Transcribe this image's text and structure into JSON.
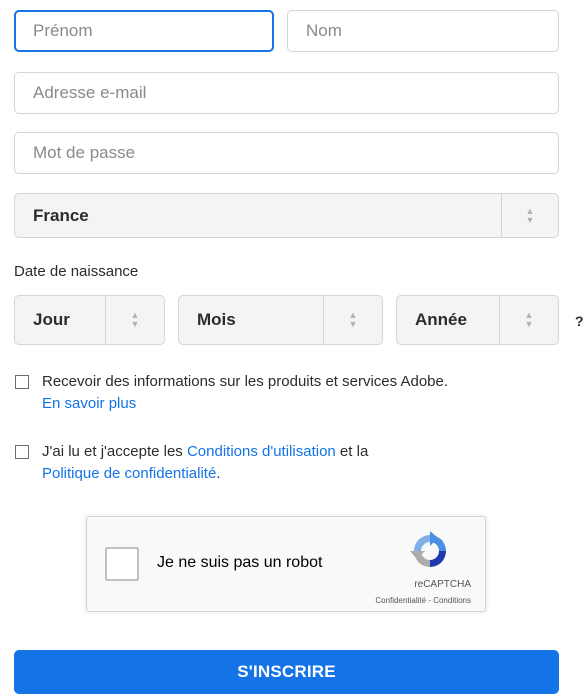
{
  "form": {
    "first_name": {
      "placeholder": "Prénom",
      "value": ""
    },
    "last_name": {
      "placeholder": "Nom",
      "value": ""
    },
    "email": {
      "placeholder": "Adresse e-mail",
      "value": ""
    },
    "password": {
      "placeholder": "Mot de passe",
      "value": ""
    },
    "country": {
      "selected": "France"
    },
    "birthdate": {
      "label": "Date de naissance",
      "day": "Jour",
      "month": "Mois",
      "year": "Année",
      "help": "?"
    },
    "newsletter": {
      "checked": false,
      "text": "Recevoir des informations sur les produits et services Adobe.",
      "link": "En savoir plus"
    },
    "terms": {
      "checked": false,
      "text_before": "J'ai lu et j'accepte les ",
      "link_terms": "Conditions d'utilisation",
      "text_middle": " et la",
      "link_privacy": "Politique de confidentialité",
      "text_after": "."
    },
    "recaptcha": {
      "label": "Je ne suis pas un robot",
      "brand": "reCAPTCHA",
      "privacy": "Confidentialité",
      "separator": " - ",
      "terms": "Conditions"
    },
    "submit_label": "S'INSCRIRE"
  },
  "colors": {
    "accent": "#1473e6",
    "border": "#d5d5d5",
    "select_bg": "#f4f4f4"
  }
}
